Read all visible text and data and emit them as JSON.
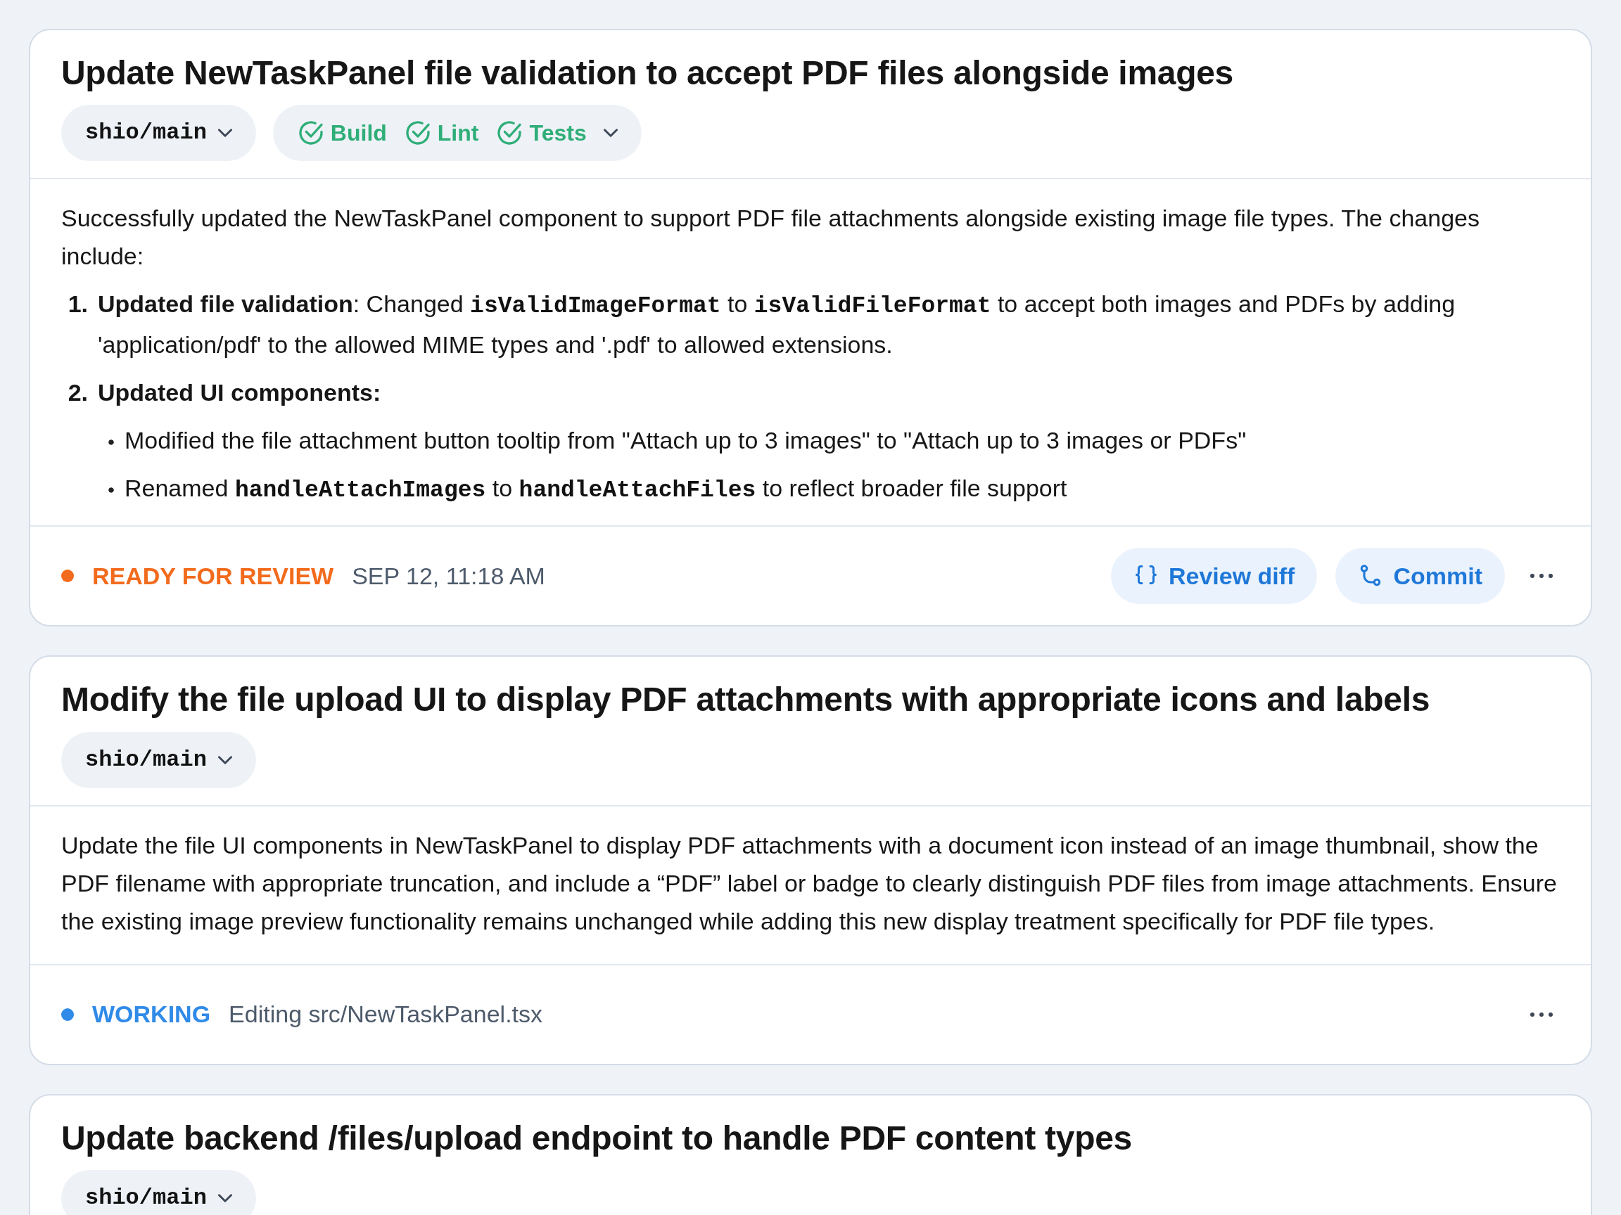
{
  "tasks": [
    {
      "title": "Update NewTaskPanel file validation to accept PDF files alongside images",
      "branch": "shio/main",
      "checks": [
        {
          "label": "Build",
          "passed": true
        },
        {
          "label": "Lint",
          "passed": true
        },
        {
          "label": "Tests",
          "passed": true
        }
      ],
      "body": [
        {
          "kind": "paragraph",
          "segments": [
            {
              "kind": "text",
              "text": "Successfully updated the NewTaskPanel component to support PDF file attachments alongside existing image file types. The changes include:"
            }
          ]
        },
        {
          "kind": "numbered",
          "number": "1.",
          "segments": [
            {
              "kind": "bold",
              "text": "Updated file validation"
            },
            {
              "kind": "text",
              "text": ": Changed "
            },
            {
              "kind": "code",
              "text": "isValidImageFormat"
            },
            {
              "kind": "text",
              "text": " to "
            },
            {
              "kind": "code",
              "text": "isValidFileFormat"
            },
            {
              "kind": "text",
              "text": " to accept both images and PDFs by adding 'application/pdf' to the allowed MIME types and '.pdf' to allowed extensions."
            }
          ]
        },
        {
          "kind": "numbered",
          "number": "2.",
          "segments": [
            {
              "kind": "bold",
              "text": "Updated UI components:"
            }
          ]
        },
        {
          "kind": "bullet",
          "segments": [
            {
              "kind": "text",
              "text": "Modified the file attachment button tooltip from \"Attach up to 3 images\" to \"Attach up to 3 images or PDFs\""
            }
          ]
        },
        {
          "kind": "bullet",
          "segments": [
            {
              "kind": "text",
              "text": "Renamed "
            },
            {
              "kind": "code",
              "text": "handleAttachImages"
            },
            {
              "kind": "text",
              "text": " to "
            },
            {
              "kind": "code",
              "text": "handleAttachFiles"
            },
            {
              "kind": "text",
              "text": " to reflect broader file support"
            }
          ]
        }
      ],
      "status": {
        "label": "READY FOR REVIEW",
        "color": "#f26b1d"
      },
      "meta": "SEP 12, 11:18 AM",
      "actions": [
        {
          "kind": "review",
          "label": "Review diff"
        },
        {
          "kind": "commit",
          "label": "Commit"
        }
      ]
    },
    {
      "title": "Modify the file upload UI to display PDF attachments with appropriate icons and labels",
      "branch": "shio/main",
      "body": [
        {
          "kind": "paragraph",
          "segments": [
            {
              "kind": "text",
              "text": "Update the file UI components in NewTaskPanel to display PDF attachments with a document icon instead of an image thumbnail, show the PDF filename with appropriate truncation, and include a “PDF” label or badge to clearly distinguish PDF files from image attachments. Ensure the existing image preview functionality remains unchanged while adding this new display treatment specifically for PDF file types."
            }
          ]
        }
      ],
      "status": {
        "label": "WORKING",
        "color": "#2f8ae8"
      },
      "meta": "Editing src/NewTaskPanel.tsx"
    },
    {
      "title": "Update backend /files/upload endpoint to handle PDF content types",
      "branch": "shio/main"
    }
  ]
}
